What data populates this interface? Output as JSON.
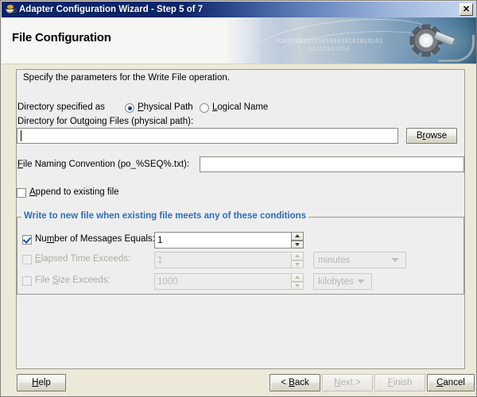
{
  "window": {
    "title": "Adapter Configuration Wizard - Step 5 of 7",
    "icon": "java-coffee-cup-icon",
    "close_label": "✕"
  },
  "banner": {
    "heading": "File Configuration",
    "art_binary_line1": "0101010101010101010101010101",
    "art_binary_line2": "01010101010",
    "gear_icon": "gear-icon"
  },
  "form": {
    "instruction": "Specify the parameters for the Write File operation.",
    "directory_specified_as": {
      "label": "Directory specified as",
      "options": [
        {
          "label": "Physical Path",
          "mnemonic": "P",
          "selected": true
        },
        {
          "label": "Logical Name",
          "mnemonic": "L",
          "selected": false
        }
      ]
    },
    "outgoing_dir": {
      "label": "Directory for Outgoing Files (physical path):",
      "value": "",
      "placeholder": "",
      "browse_label": "Browse",
      "browse_mnemonic": "r"
    },
    "naming_convention": {
      "label": "File Naming Convention (po_%SEQ%.txt):",
      "mnemonic": "F",
      "value": "",
      "placeholder": ""
    },
    "append_existing": {
      "label": "Append to existing file",
      "mnemonic": "A",
      "checked": false
    }
  },
  "conditions_group": {
    "legend": "Write to new file when existing file meets any of these conditions",
    "legend_color": "#2f6dbd",
    "rows": [
      {
        "label": "Number of Messages Equals:",
        "mnemonic": "m",
        "checked": true,
        "enabled": true,
        "value": "1",
        "unit": null
      },
      {
        "label": "Elapsed Time Exceeds:",
        "mnemonic": "E",
        "checked": false,
        "enabled": false,
        "value": "1",
        "unit": "minutes"
      },
      {
        "label": "File Size Exceeds:",
        "mnemonic": "S",
        "checked": false,
        "enabled": false,
        "value": "1000",
        "unit": "kilobytes"
      }
    ]
  },
  "footer": {
    "help": {
      "label": "Help",
      "mnemonic": "H",
      "enabled": true
    },
    "back": {
      "label": "< Back",
      "mnemonic": "B",
      "enabled": true
    },
    "next": {
      "label": "Next >",
      "mnemonic": "N",
      "enabled": false
    },
    "finish": {
      "label": "Finish",
      "mnemonic": "F",
      "enabled": false
    },
    "cancel": {
      "label": "Cancel",
      "mnemonic": "C",
      "enabled": true
    }
  }
}
